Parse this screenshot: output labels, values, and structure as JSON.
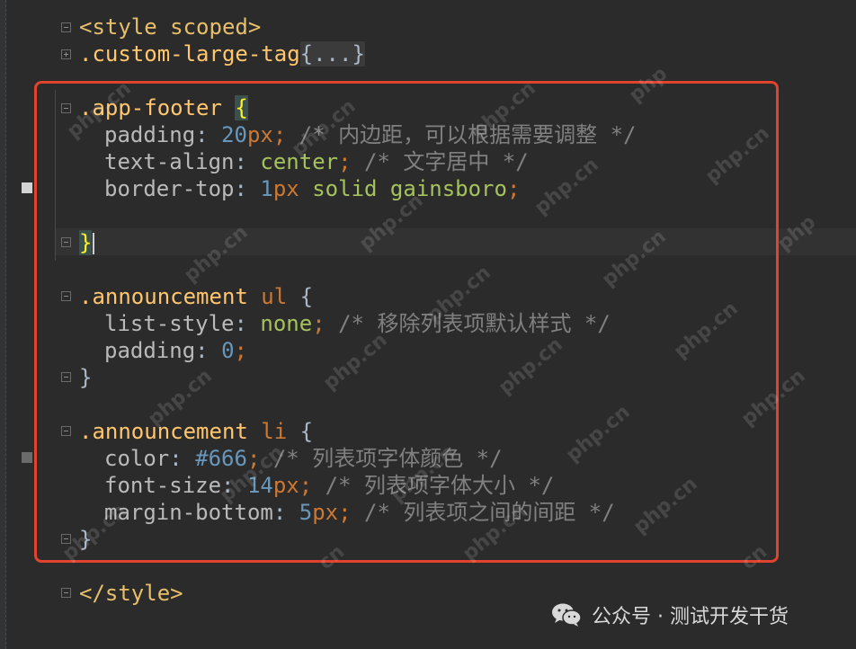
{
  "editor": {
    "lines": {
      "style_open": "<style scoped>",
      "custom_large_tag": {
        "selector": ".custom-large-tag",
        "collapsed": "{...}"
      },
      "app_footer": {
        "selector": ".app-footer",
        "open": "{",
        "padding_prop": "padding",
        "padding_num": "20",
        "padding_unit": "px",
        "padding_comment": "/* 内边距，可以根据需要调整 */",
        "align_prop": "text-align",
        "align_value": "center",
        "align_comment": "/* 文字居中 */",
        "border_prop": "border-top",
        "border_num": "1",
        "border_unit": "px",
        "border_value": "solid gainsboro",
        "close": "}"
      },
      "announcement_ul": {
        "selector": ".announcement",
        "tag": "ul",
        "open": "{",
        "list_style_prop": "list-style",
        "list_style_value": "none",
        "list_style_comment": "/* 移除列表项默认样式 */",
        "padding_prop": "padding",
        "padding_num": "0",
        "close": "}"
      },
      "announcement_li": {
        "selector": ".announcement",
        "tag": "li",
        "open": "{",
        "color_prop": "color",
        "color_value": "#666",
        "color_comment": "/* 列表项字体颜色 */",
        "font_size_prop": "font-size",
        "font_size_num": "14",
        "font_size_unit": "px",
        "font_size_comment": "/* 列表项字体大小 */",
        "margin_prop": "margin-bottom",
        "margin_num": "5",
        "margin_unit": "px",
        "margin_comment": "/* 列表项之间的间距 */",
        "close": "}"
      },
      "style_close": "</style>"
    }
  },
  "watermark": {
    "text": "php.cn",
    "partial_cn": "cn",
    "partial_php": "php"
  },
  "footer": {
    "label": "公众号 · 测试开发干货",
    "icon": "wechat-icon"
  },
  "colors": {
    "highlight_border": "#e0442f",
    "background": "#2b2b2b"
  }
}
